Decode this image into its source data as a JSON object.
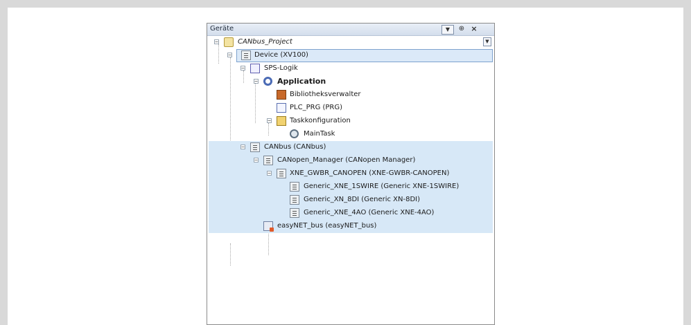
{
  "panel": {
    "title": "Geräte",
    "dropdown_glyph": "▼",
    "pin_glyph": "⊕",
    "close_glyph": "×"
  },
  "tree": {
    "project": "CANbus_Project",
    "device": "Device (XV100)",
    "sps_logic": "SPS-Logik",
    "application": "Application",
    "library_manager": "Bibliotheksverwalter",
    "plc_prg": "PLC_PRG (PRG)",
    "task_config": "Taskkonfiguration",
    "main_task": "MainTask",
    "canbus": "CANbus (CANbus)",
    "canopen_manager": "CANopen_Manager (CANopen Manager)",
    "xne_gwbr": "XNE_GWBR_CANOPEN (XNE-GWBR-CANOPEN)",
    "generic_1swire": "Generic_XNE_1SWIRE (Generic XNE-1SWIRE)",
    "generic_8di": "Generic_XN_8DI (Generic XN-8DI)",
    "generic_4ao": "Generic_XNE_4AO (Generic XNE-4AO)",
    "easynet": "easyNET_bus (easyNET_bus)"
  },
  "expander_minus": "−"
}
